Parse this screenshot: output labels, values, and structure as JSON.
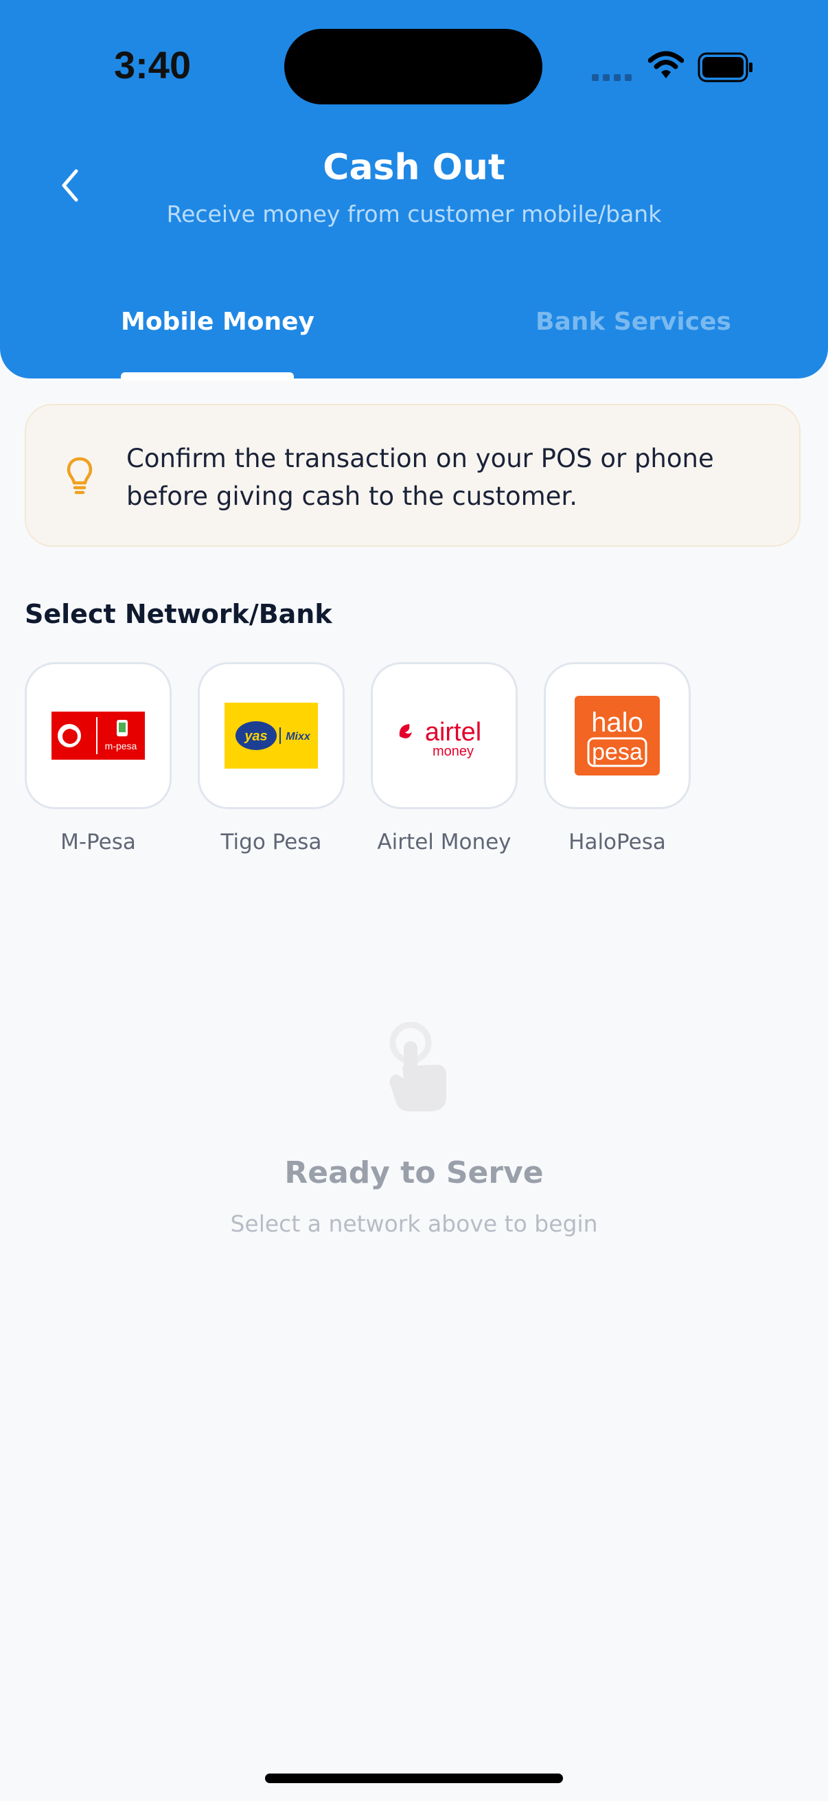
{
  "status_bar": {
    "time": "3:40"
  },
  "header": {
    "title": "Cash Out",
    "subtitle": "Receive money from customer mobile/bank",
    "background_color": "#1f88e5"
  },
  "tabs": [
    {
      "label": "Mobile Money",
      "active": true
    },
    {
      "label": "Bank Services",
      "active": false
    }
  ],
  "tip": {
    "icon": "lightbulb-icon",
    "text": "Confirm the transaction on your POS or phone before giving cash to the customer."
  },
  "section": {
    "title": "Select Network/Bank"
  },
  "networks": [
    {
      "label": "M-Pesa",
      "logo": "mpesa-logo",
      "logo_text": "m-pesa",
      "brand_color": "#e60000"
    },
    {
      "label": "Tigo Pesa",
      "logo": "yas-mixx-logo",
      "logo_text_1": "yas",
      "logo_text_2": "Mixx",
      "brand_color": "#ffd400"
    },
    {
      "label": "Airtel Money",
      "logo": "airtel-logo",
      "logo_text_1": "airtel",
      "logo_text_2": "money",
      "brand_color": "#e4002b"
    },
    {
      "label": "HaloPesa",
      "logo": "halopesa-logo",
      "logo_text_1": "halo",
      "logo_text_2": "pesa",
      "brand_color": "#f26522"
    }
  ],
  "empty_state": {
    "icon": "tap-hand-icon",
    "title": "Ready to Serve",
    "subtitle": "Select a network above to begin"
  }
}
